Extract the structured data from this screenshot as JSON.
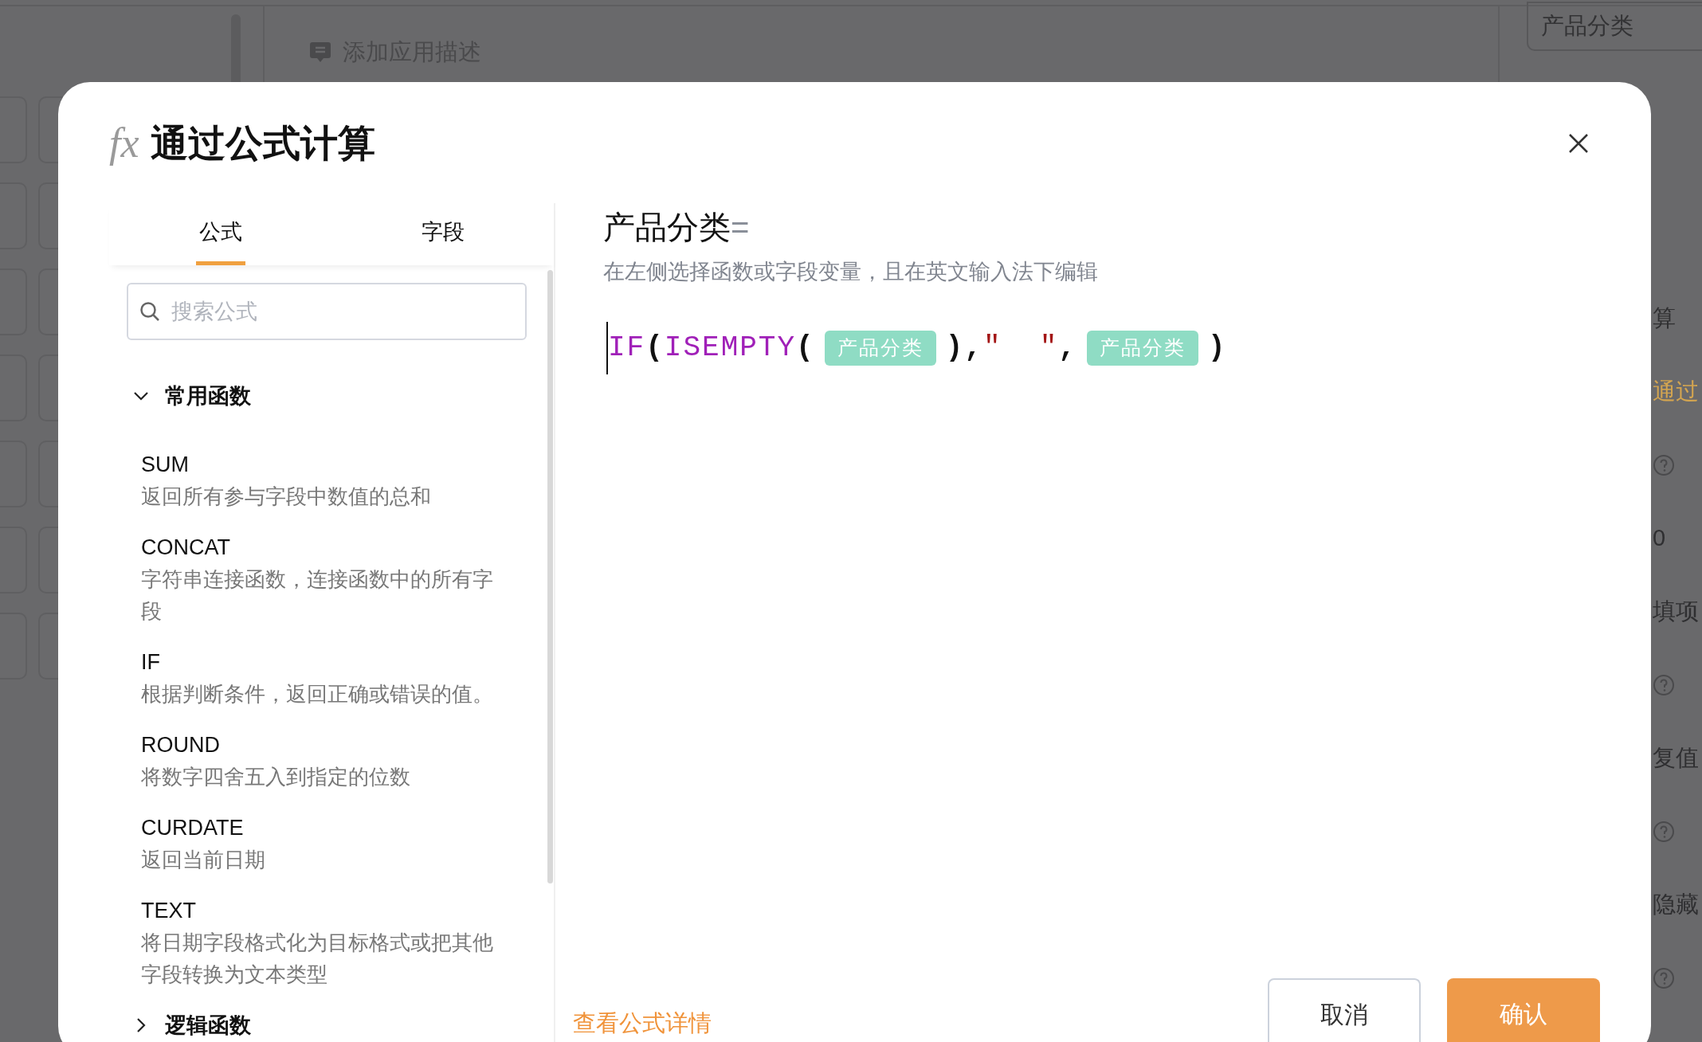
{
  "background": {
    "description_link": "添加应用描述",
    "field_value": "产品分类",
    "side_texts": [
      {
        "kind": "text",
        "text": "算"
      },
      {
        "kind": "accent",
        "text": "通过"
      },
      {
        "kind": "help"
      },
      {
        "kind": "text",
        "text": "0"
      },
      {
        "kind": "text",
        "text": "填项"
      },
      {
        "kind": "help"
      },
      {
        "kind": "text",
        "text": "复值"
      },
      {
        "kind": "help"
      },
      {
        "kind": "text",
        "text": "隐藏"
      },
      {
        "kind": "help"
      }
    ]
  },
  "dialog": {
    "title_icon": "fx",
    "title": "通过公式计算",
    "tabs": [
      {
        "label": "公式",
        "selected": true
      },
      {
        "label": "字段",
        "selected": false
      }
    ],
    "search": {
      "placeholder": "搜索公式"
    },
    "groups": [
      {
        "name": "常用函数",
        "expanded": true,
        "items": [
          {
            "name": "SUM",
            "description": "返回所有参与字段中数值的总和"
          },
          {
            "name": "CONCAT",
            "description": "字符串连接函数，连接函数中的所有字段"
          },
          {
            "name": "IF",
            "description": "根据判断条件，返回正确或错误的值。"
          },
          {
            "name": "ROUND",
            "description": "将数字四舍五入到指定的位数"
          },
          {
            "name": "CURDATE",
            "description": "返回当前日期"
          },
          {
            "name": "TEXT",
            "description": "将日期字段格式化为目标格式或把其他字段转换为文本类型"
          }
        ]
      },
      {
        "name": "逻辑函数",
        "expanded": false
      }
    ],
    "target_field": "产品分类",
    "equals": "=",
    "hint": "在左侧选择函数或字段变量，且在英文输入法下编辑",
    "formula": [
      {
        "kind": "function",
        "text": "IF"
      },
      {
        "kind": "punct",
        "text": "("
      },
      {
        "kind": "function",
        "text": "ISEMPTY"
      },
      {
        "kind": "punct",
        "text": "("
      },
      {
        "kind": "field",
        "text": "产品分类"
      },
      {
        "kind": "punct",
        "text": ")"
      },
      {
        "kind": "punct",
        "text": ","
      },
      {
        "kind": "string",
        "text": "\"  \""
      },
      {
        "kind": "punct",
        "text": ","
      },
      {
        "kind": "field",
        "text": "产品分类"
      },
      {
        "kind": "punct",
        "text": ")"
      }
    ],
    "details_link": "查看公式详情",
    "buttons": [
      {
        "kind": "secondary",
        "label": "取消"
      },
      {
        "kind": "primary",
        "label": "确认"
      }
    ]
  }
}
